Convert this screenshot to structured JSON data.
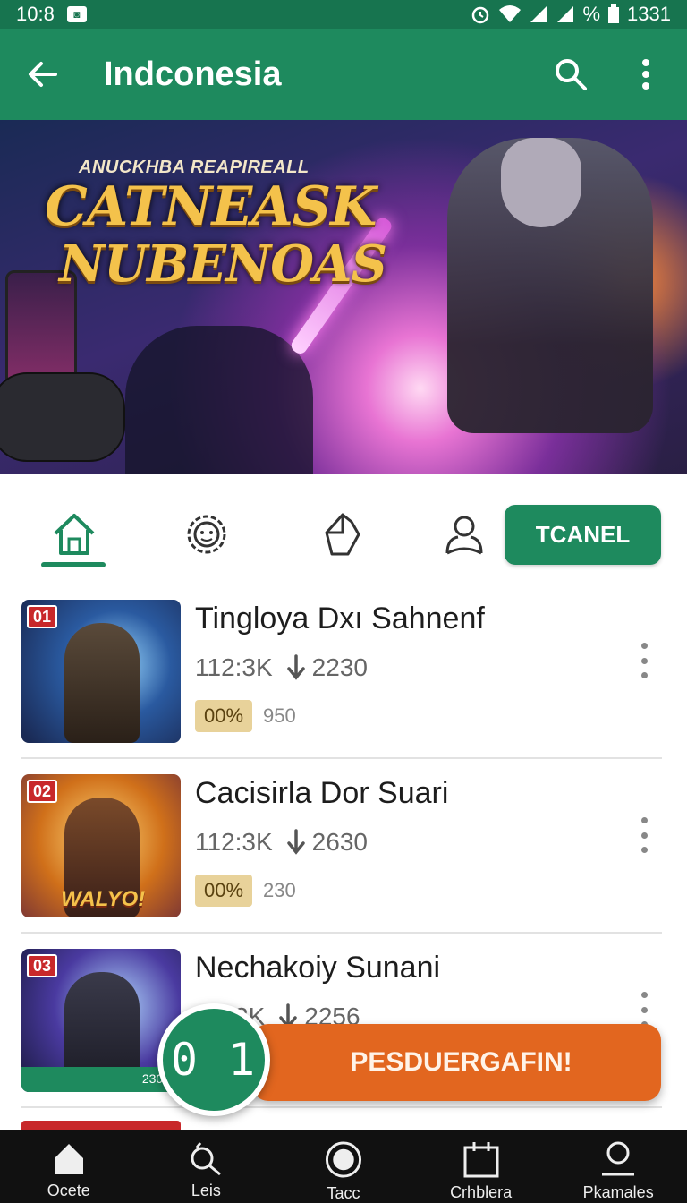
{
  "status_bar": {
    "time": "10:8",
    "battery_text": "1331",
    "percent_sign": "%"
  },
  "app_bar": {
    "title": "Indconesia"
  },
  "hero": {
    "tagline": "ANUCKHBA REAPIREALL",
    "title_line1": "CATNEASK",
    "title_line2": "NUBENOAS"
  },
  "tabs": [
    {
      "icon": "home-icon",
      "active": true
    },
    {
      "icon": "gear-face-icon",
      "active": false
    },
    {
      "icon": "tag-icon",
      "active": false
    },
    {
      "icon": "person-icon",
      "active": false
    }
  ],
  "tab_button": {
    "label": "TCANEL"
  },
  "list": [
    {
      "rank": "01",
      "name": "Tingloya Dxı Sahnenf",
      "players": "112:3K",
      "downloads": "2230",
      "pct": "00%",
      "count": "950"
    },
    {
      "rank": "02",
      "name": "Cacisirla Dor Suari",
      "players": "112:3K",
      "downloads": "2630",
      "pct": "00%",
      "count": "230",
      "thumb_logo": "WALYO!"
    },
    {
      "rank": "03",
      "name": "Nechakoiy Sunani",
      "players": "3K",
      "downloads": "2256",
      "thumb_footer": "2309"
    }
  ],
  "fab": {
    "label": "0 1"
  },
  "cta": {
    "label": "PESDUERGAFIN!"
  },
  "bottom_nav": [
    {
      "icon": "home-icon",
      "label": "Ocete"
    },
    {
      "icon": "search-icon",
      "label": "Leis"
    },
    {
      "icon": "circle-icon",
      "label": "Tacc"
    },
    {
      "icon": "calendar-icon",
      "label": "Crhblera"
    },
    {
      "icon": "profile-icon",
      "label": "Pkamales"
    }
  ],
  "colors": {
    "primary": "#1e8a5e",
    "status_bar": "#17744f",
    "accent": "#e2661f",
    "nav_bg": "#111111"
  }
}
